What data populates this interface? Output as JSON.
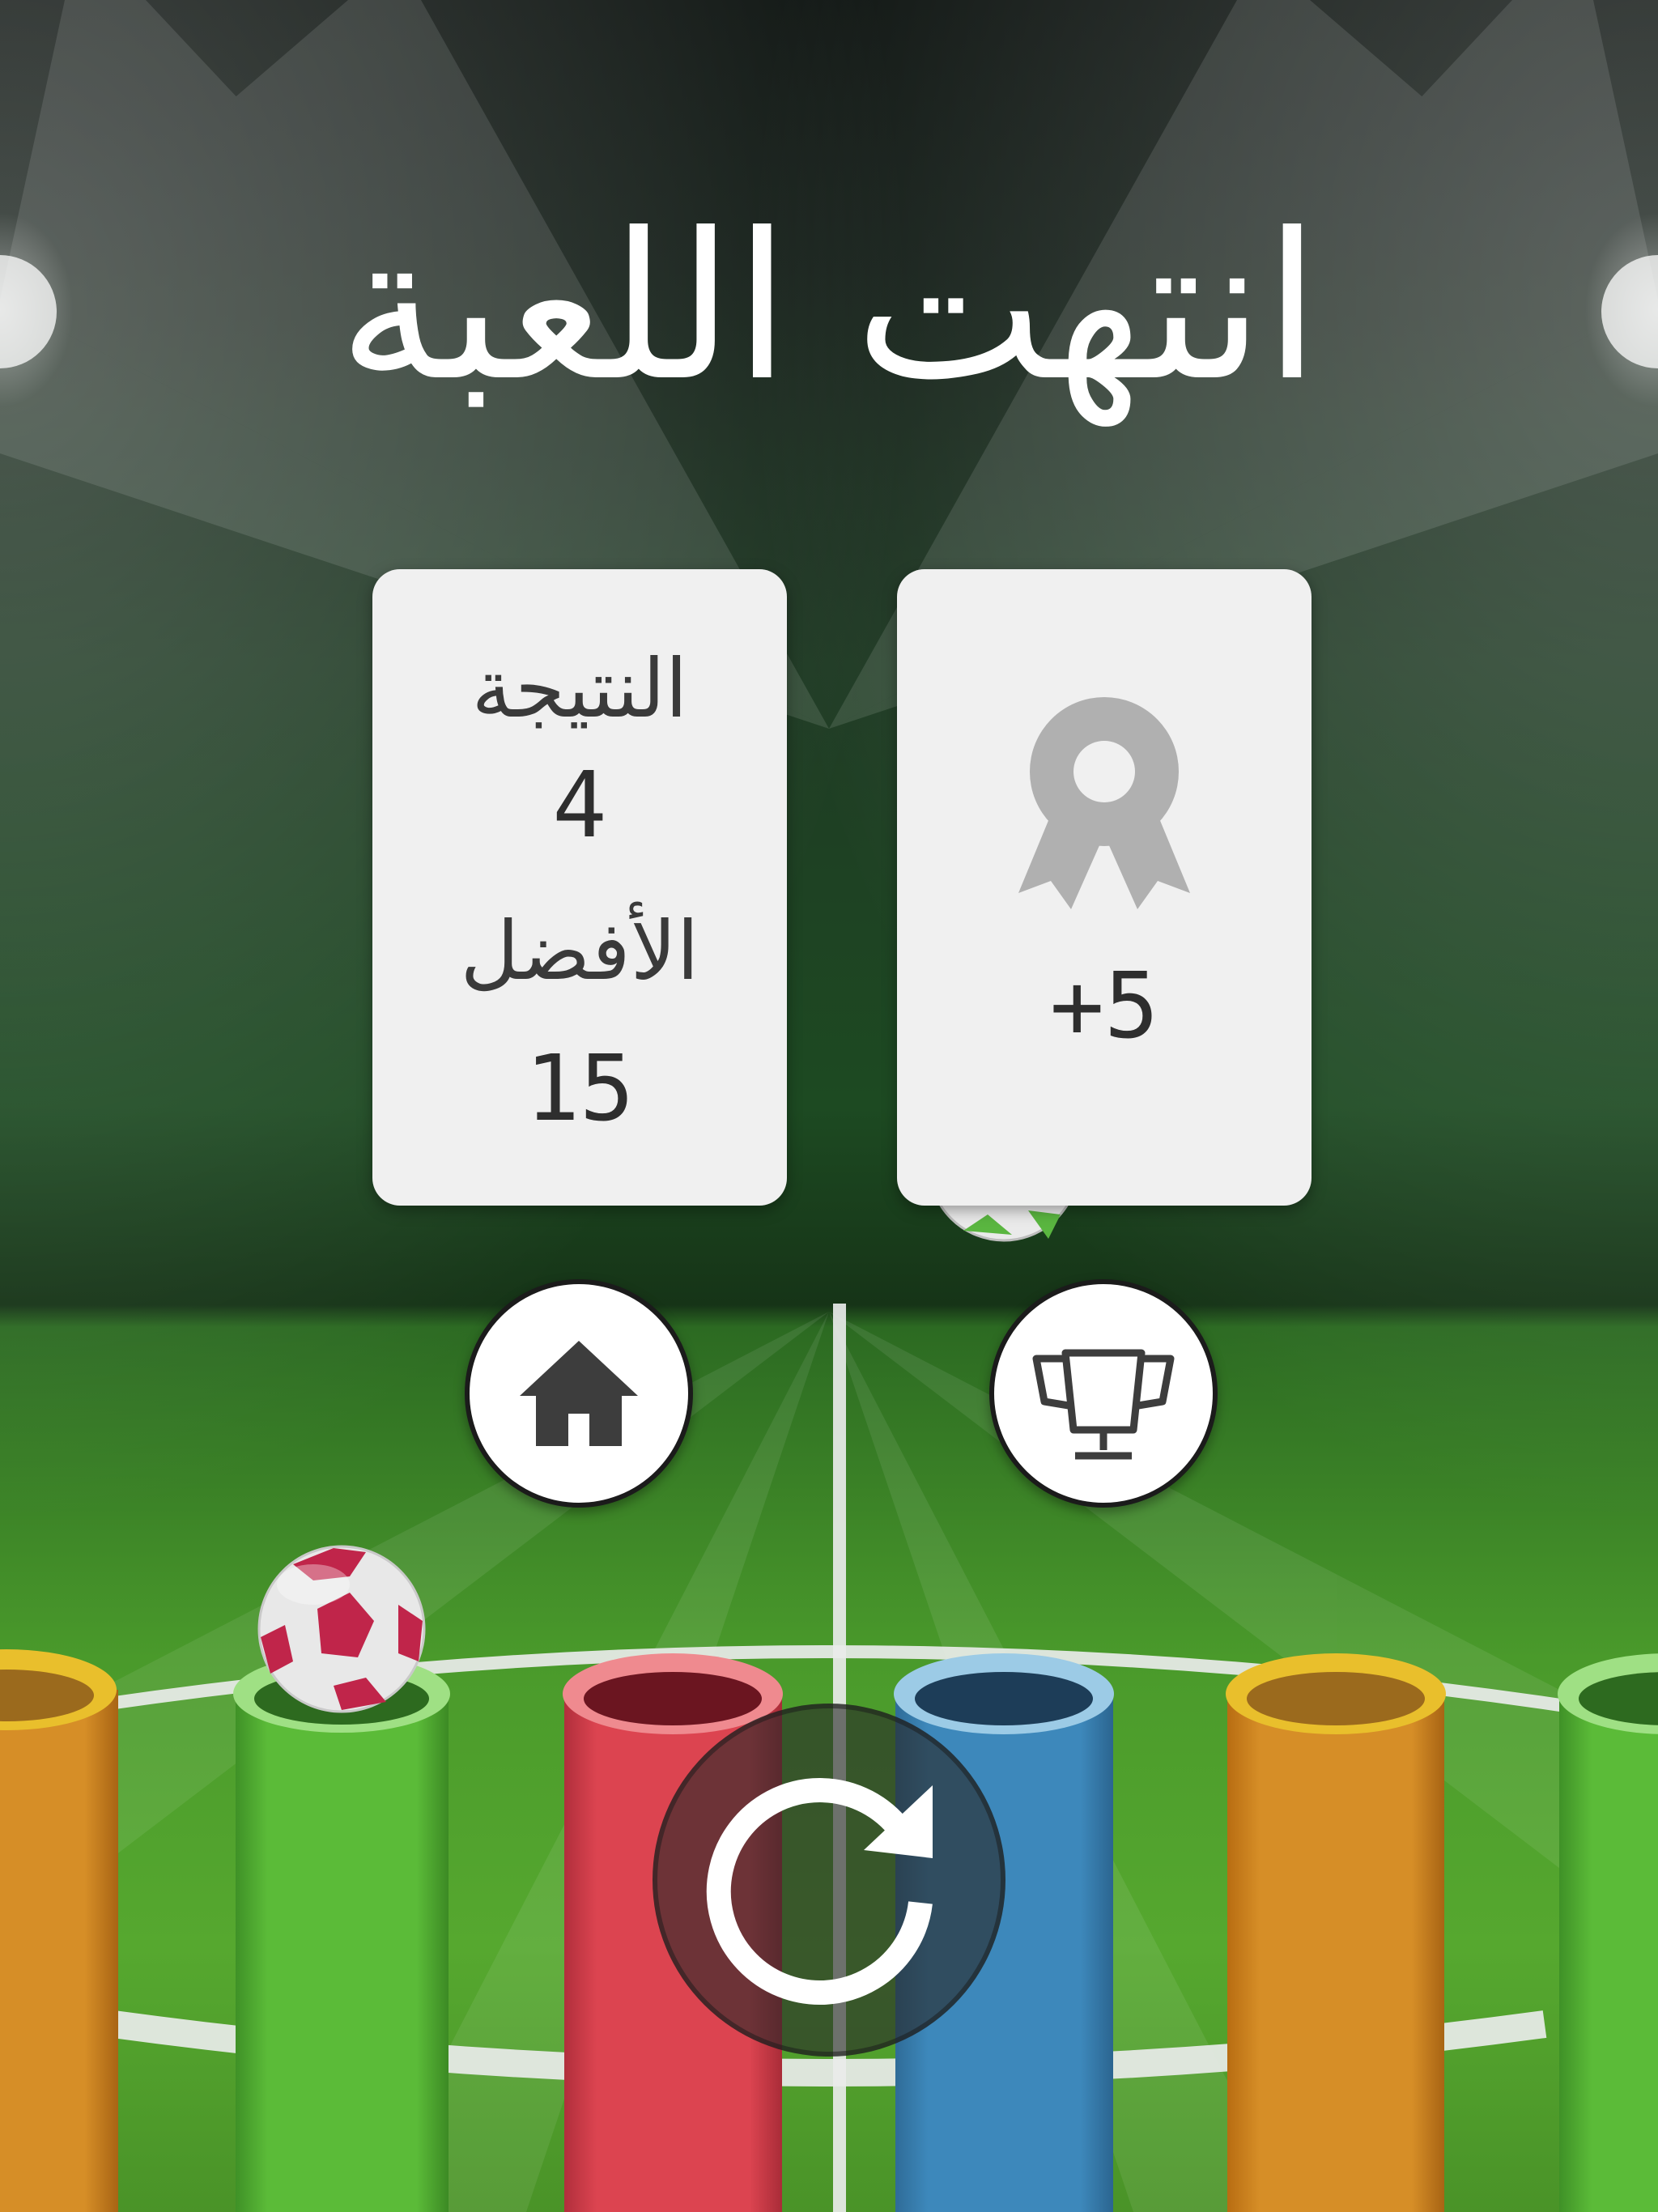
{
  "title": "انتهت اللعبة",
  "score_card": {
    "score_label": "النتيجة",
    "score_value": "4",
    "best_label": "الأفضل",
    "best_value": "15"
  },
  "reward_card": {
    "icon": "award-ribbon-icon",
    "reward_value": "+5"
  },
  "buttons": {
    "home_icon": "home-icon",
    "leaderboard_icon": "trophy-icon",
    "restart_icon": "restart-icon"
  },
  "colors": {
    "tube_orange": "#d38b26",
    "tube_green": "#58b637",
    "tube_red": "#d9424f",
    "tube_blue": "#3b85b8",
    "card_bg": "#f0f0f0",
    "title_text": "#ffffff"
  }
}
